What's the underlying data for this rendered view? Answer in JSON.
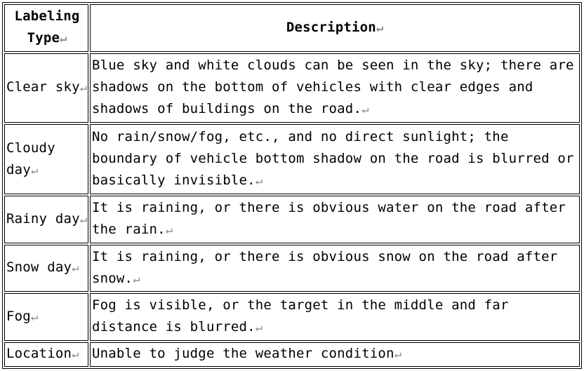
{
  "table": {
    "header": {
      "type_label": "Labeling Type",
      "description_label": "Description",
      "mark": "↵"
    },
    "rows": [
      {
        "type": "Clear sky",
        "description": "Blue sky and white clouds can be seen in the sky; there are shadows on the bottom of vehicles with clear edges and shadows of buildings on the road."
      },
      {
        "type": "Cloudy day",
        "description": "No rain/snow/fog, etc., and no direct sunlight; the boundary of vehicle bottom shadow on the road is blurred or basically invisible."
      },
      {
        "type": "Rainy day",
        "description": "It is raining, or there is obvious water on the road after the rain."
      },
      {
        "type": "Snow day",
        "description": "It is raining, or there is obvious snow on the road after snow."
      },
      {
        "type": "Fog",
        "description": "Fog is visible, or the target in the middle and far distance is blurred."
      },
      {
        "type": "Location",
        "description": "Unable to judge the weather condition"
      }
    ]
  }
}
